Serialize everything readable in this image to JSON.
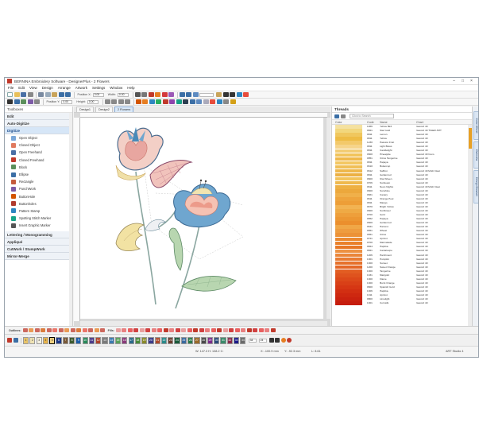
{
  "window": {
    "title": "BERNINA Embroidery Software - DesignerPlus - 2 Flowers"
  },
  "menu": [
    "File",
    "Edit",
    "View",
    "Design",
    "Arrange",
    "Artwork",
    "Settings",
    "Window",
    "Help"
  ],
  "toolbar": {
    "pos_x_label": "Position X:",
    "pos_y_label": "Position Y:",
    "width_label": "Width:",
    "height_label": "Height:",
    "pos_x": "0.00",
    "pos_y": "0.00",
    "width": "0.00",
    "height": "0.00"
  },
  "left_panel": {
    "title": "Toolboxes",
    "sections_top": [
      "Edit",
      "Auto-Digitize"
    ],
    "active_section": "Digitize",
    "tools": [
      {
        "label": "Open Object",
        "icon": "open-object-icon",
        "color": "#7aa7d9"
      },
      {
        "label": "Closed Object",
        "icon": "closed-object-icon",
        "color": "#e07a5f"
      },
      {
        "label": "Open Freehand",
        "icon": "open-freehand-icon",
        "color": "#4a6fa5"
      },
      {
        "label": "Closed Freehand",
        "icon": "closed-freehand-icon",
        "color": "#c0392b"
      },
      {
        "label": "Block",
        "icon": "block-icon",
        "color": "#5b8f5b"
      },
      {
        "label": "Ellipse",
        "icon": "ellipse-icon",
        "color": "#3b6ea5"
      },
      {
        "label": "Rectangle",
        "icon": "rectangle-icon",
        "color": "#c45b3c"
      },
      {
        "label": "PunchWork",
        "icon": "punchwork-icon",
        "color": "#7d5ba6"
      },
      {
        "label": "ButtonHole",
        "icon": "buttonhole-icon",
        "color": "#d35400"
      },
      {
        "label": "Buttonholes",
        "icon": "buttonholes-icon",
        "color": "#b03a2e"
      },
      {
        "label": "Pattern Stamp",
        "icon": "pattern-stamp-icon",
        "color": "#2e86c1"
      },
      {
        "label": "Spotting Stitch Marker",
        "icon": "spotting-stitch-icon",
        "color": "#17a589"
      },
      {
        "label": "Insert Graphic Marker",
        "icon": "graphic-marker-icon",
        "color": "#555555"
      }
    ],
    "sections_bottom": [
      "Lettering / Monogramming",
      "Appliqué",
      "CutWork / StumpWork",
      "Mirror-Merge"
    ]
  },
  "doc_tabs": [
    "Design1",
    "Design2",
    "2 Flowers"
  ],
  "threads": {
    "title": "Threads",
    "search_placeholder": "Click to Search",
    "columns": [
      "Color",
      "Code",
      "Name",
      "Chart"
    ],
    "rows": [
      {
        "color": "#f4e1a0",
        "code": "1066",
        "name": "Yellow Bird",
        "chart": "Isacord 40"
      },
      {
        "color": "#f2d77d",
        "code": "0821",
        "name": "Star Gold",
        "chart": "Isacord 40 TIGER-SHT"
      },
      {
        "color": "#f0c75e",
        "code": "0811",
        "name": "Lemon",
        "chart": "Isacord 40"
      },
      {
        "color": "#eebc45",
        "code": "0811",
        "name": "Yellow",
        "chart": "Isacord 40"
      },
      {
        "color": "#f3c96a",
        "code": "1230",
        "name": "Passion Fruit",
        "chart": "Isacord 40"
      },
      {
        "color": "#f6d48a",
        "code": "0811",
        "name": "Light Brass",
        "chart": "Isacord 40"
      },
      {
        "color": "#f2cc73",
        "code": "0811",
        "name": "Candlelight",
        "chart": "Isacord 40"
      },
      {
        "color": "#f1c35a",
        "code": "0600",
        "name": "Pineapple",
        "chart": "Isacord 40 Coco"
      },
      {
        "color": "#efb84a",
        "code": "0851",
        "name": "Citrus Tangerine",
        "chart": "Isacord 40"
      },
      {
        "color": "#f3c761",
        "code": "0811",
        "name": "Papaya",
        "chart": "Isacord 40"
      },
      {
        "color": "#f0bf56",
        "code": "0610",
        "name": "Buttercup",
        "chart": "Isacord 40"
      },
      {
        "color": "#eeb74a",
        "code": "0612",
        "name": "Saffron",
        "chart": "Isacord 40 Multi Clear"
      },
      {
        "color": "#ecb043",
        "code": "0811",
        "name": "Goldenrod",
        "chart": "Isacord 40"
      },
      {
        "color": "#f2c35b",
        "code": "0600",
        "name": "Kiwi Sheen",
        "chart": "Isacord 40"
      },
      {
        "color": "#efb94e",
        "code": "0706",
        "name": "Sunbeam",
        "chart": "Isacord 40"
      },
      {
        "color": "#eeb043",
        "code": "0611",
        "name": "Neon Nights",
        "chart": "Isacord 40 Multi Clear"
      },
      {
        "color": "#eca83c",
        "code": "0600",
        "name": "Sunshine",
        "chart": "Isacord 40"
      },
      {
        "color": "#f0b04a",
        "code": "0661",
        "name": "Canary",
        "chart": "Isacord 40"
      },
      {
        "color": "#eea43d",
        "code": "0611",
        "name": "Orange Peel",
        "chart": "Isacord 40"
      },
      {
        "color": "#ed9e37",
        "code": "0811",
        "name": "Mango",
        "chart": "Isacord 40"
      },
      {
        "color": "#f2b352",
        "code": "0670",
        "name": "Bright Yellow",
        "chart": "Isacord 40"
      },
      {
        "color": "#efaa45",
        "code": "0600",
        "name": "Sunflower",
        "chart": "Isacord 40"
      },
      {
        "color": "#ee9f3b",
        "code": "0700",
        "name": "Gold",
        "chart": "Isacord 40"
      },
      {
        "color": "#ec9733",
        "code": "0652",
        "name": "Papaya",
        "chart": "Isacord 40"
      },
      {
        "color": "#eb8f2d",
        "code": "0600",
        "name": "Goldenrod",
        "chart": "Isacord 40"
      },
      {
        "color": "#f0a747",
        "code": "0641",
        "name": "Harvest",
        "chart": "Isacord 40"
      },
      {
        "color": "#ee9c3f",
        "code": "0651",
        "name": "Wheat",
        "chart": "Isacord 40"
      },
      {
        "color": "#ec9237",
        "code": "0651",
        "name": "Citrus",
        "chart": "Isacord 40"
      },
      {
        "color": "#ea8930",
        "code": "0721",
        "name": "Apricot",
        "chart": "Isacord 40"
      },
      {
        "color": "#e9802a",
        "code": "0700",
        "name": "Marmalade",
        "chart": "Isacord 40"
      },
      {
        "color": "#e77725",
        "code": "0824",
        "name": "Paprika",
        "chart": "Isacord 40"
      },
      {
        "color": "#ed9142",
        "code": "0821",
        "name": "Cantaloupe",
        "chart": "Isacord 40"
      },
      {
        "color": "#ea8539",
        "code": "1206",
        "name": "Parchment",
        "chart": "Isacord 40"
      },
      {
        "color": "#e87b32",
        "code": "1301",
        "name": "Pumpkin",
        "chart": "Isacord 40"
      },
      {
        "color": "#e6712b",
        "code": "1300",
        "name": "Sunset",
        "chart": "Isacord 40"
      },
      {
        "color": "#e46726",
        "code": "1200",
        "name": "Sweet Orange",
        "chart": "Isacord 40"
      },
      {
        "color": "#e25d22",
        "code": "1300",
        "name": "Tangerine",
        "chart": "Isacord 40"
      },
      {
        "color": "#df531e",
        "code": "1331",
        "name": "Marigold",
        "chart": "Isacord 40"
      },
      {
        "color": "#dc491a",
        "code": "1300",
        "name": "Flame",
        "chart": "Isacord 40"
      },
      {
        "color": "#d94017",
        "code": "1300",
        "name": "Burnt Orange",
        "chart": "Isacord 40"
      },
      {
        "color": "#d63714",
        "code": "0600",
        "name": "Spanish Gold",
        "chart": "Isacord 40"
      },
      {
        "color": "#d22f12",
        "code": "1306",
        "name": "Paprika",
        "chart": "Isacord 40"
      },
      {
        "color": "#ce2810",
        "code": "1311",
        "name": "Apricot",
        "chart": "Isacord 40"
      },
      {
        "color": "#ca220f",
        "code": "0800",
        "name": "Limelight",
        "chart": "Isacord 40"
      },
      {
        "color": "#c61d0e",
        "code": "1301",
        "name": "Cornsilk",
        "chart": "Isacord 40"
      }
    ]
  },
  "side_tabs": [
    "Color Wheel",
    "Overview",
    "Design Browser"
  ],
  "outline_bar": {
    "outlines_label": "Outlines:",
    "fills_label": "Fills:"
  },
  "palette": [
    {
      "label": "1",
      "color": "#e8c46a"
    },
    {
      "label": "2",
      "color": "#efe3b5"
    },
    {
      "label": "3",
      "color": "#f4f0e0"
    },
    {
      "label": "4",
      "color": "#e7b44c"
    },
    {
      "label": "5",
      "color": "#f0d080"
    },
    {
      "label": "6",
      "color": "#1e3a8a"
    },
    {
      "label": "7",
      "color": "#7a5a3a"
    },
    {
      "label": "8",
      "color": "#3c5a2e"
    },
    {
      "label": "9",
      "color": "#1f5fa8"
    },
    {
      "label": "10",
      "color": "#2a8a5a"
    },
    {
      "label": "11",
      "color": "#4b3a8a"
    },
    {
      "label": "12",
      "color": "#b0442a"
    },
    {
      "label": "13",
      "color": "#7a7a7a"
    },
    {
      "label": "14",
      "color": "#3a7ab0"
    },
    {
      "label": "15",
      "color": "#5aa05a"
    },
    {
      "label": "16",
      "color": "#8a3a7a"
    },
    {
      "label": "17",
      "color": "#2a6a8a"
    },
    {
      "label": "18",
      "color": "#4a8a3a"
    },
    {
      "label": "19",
      "color": "#8a8a2a"
    },
    {
      "label": "20",
      "color": "#3a3a8a"
    },
    {
      "label": "21",
      "color": "#b04a2a"
    },
    {
      "label": "22",
      "color": "#2a8a8a"
    },
    {
      "label": "23",
      "color": "#6a3a2a"
    },
    {
      "label": "24",
      "color": "#1a5a3a"
    },
    {
      "label": "25",
      "color": "#3a6aa0"
    },
    {
      "label": "26",
      "color": "#2a7a4a"
    },
    {
      "label": "27",
      "color": "#9a6a2a"
    },
    {
      "label": "28",
      "color": "#4a4a4a"
    },
    {
      "label": "29",
      "color": "#7a2a8a"
    },
    {
      "label": "30",
      "color": "#2a4a7a"
    },
    {
      "label": "31",
      "color": "#3a8a6a"
    },
    {
      "label": "32",
      "color": "#8a2a4a"
    },
    {
      "label": "33",
      "color": "#1a1a8a"
    },
    {
      "label": "34",
      "color": "#6a6a6a"
    }
  ],
  "palette_fields": {
    "count": "34",
    "value": "24"
  },
  "statusbar": {
    "coords": "W: 147.3  H: 138.2  C:",
    "x": "X: -100.9 mm",
    "y": "Y: -92.3 mm",
    "zoom": "L: 8.61",
    "mode": "ART Studio 4"
  }
}
